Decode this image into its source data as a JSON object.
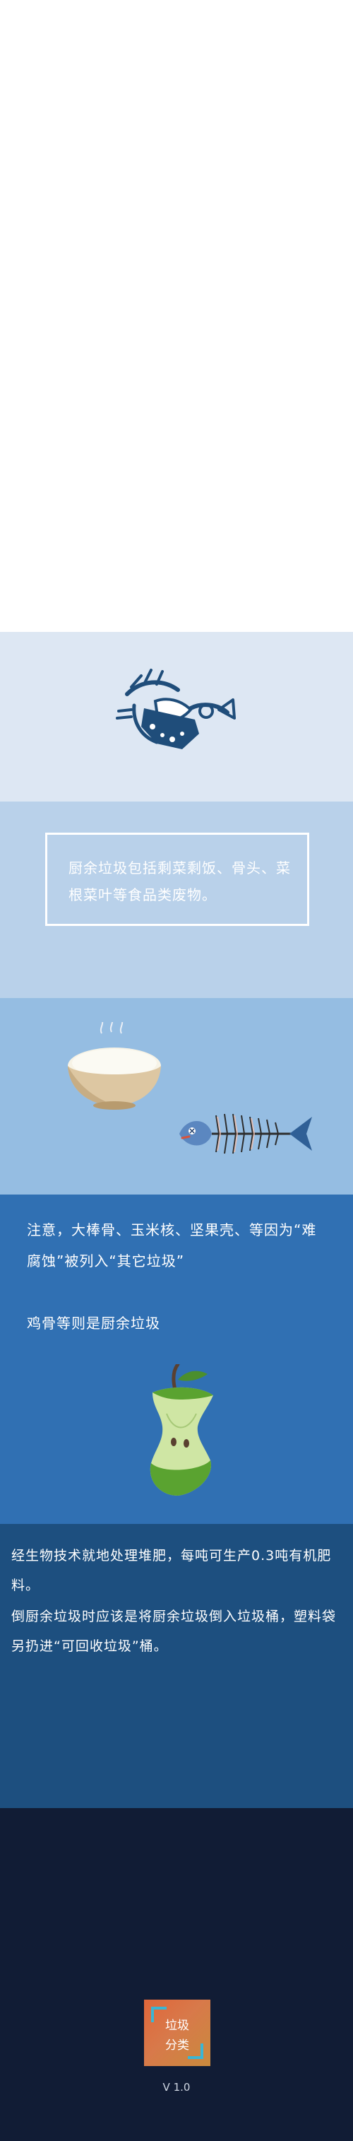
{
  "box": {
    "text": "厨余垃圾包括剩菜剩饭、骨头、菜根菜叶等食品类废物。"
  },
  "note": {
    "line1": "注意，大棒骨、玉米核、坚果壳、等因为“难腐蚀”被列入“其它垃圾”",
    "line2": "鸡骨等则是厨余垃圾"
  },
  "info": {
    "p1": "经生物技术就地处理堆肥，每吨可生产0.3吨有机肥料。",
    "p2": "倒厨余垃圾时应该是将厨余垃圾倒入垃圾桶，塑料袋另扔进“可回收垃圾”桶。"
  },
  "footer": {
    "app_icon_line1": "垃圾",
    "app_icon_line2": "分类",
    "version": "V 1.0"
  },
  "colors": {
    "s1": "#ffffff",
    "s2": "#dde7f3",
    "s3": "#b9d1ea",
    "s4": "#95bde2",
    "s5": "#3070b3",
    "s6": "#1d4f7f",
    "s7": "#111c35",
    "accent_cyan": "#3ab6d4",
    "icon_orange": "#e0663a"
  },
  "icons": [
    "fish-bone-logo-icon",
    "rice-bowl-icon",
    "fish-skeleton-icon",
    "apple-core-icon"
  ]
}
